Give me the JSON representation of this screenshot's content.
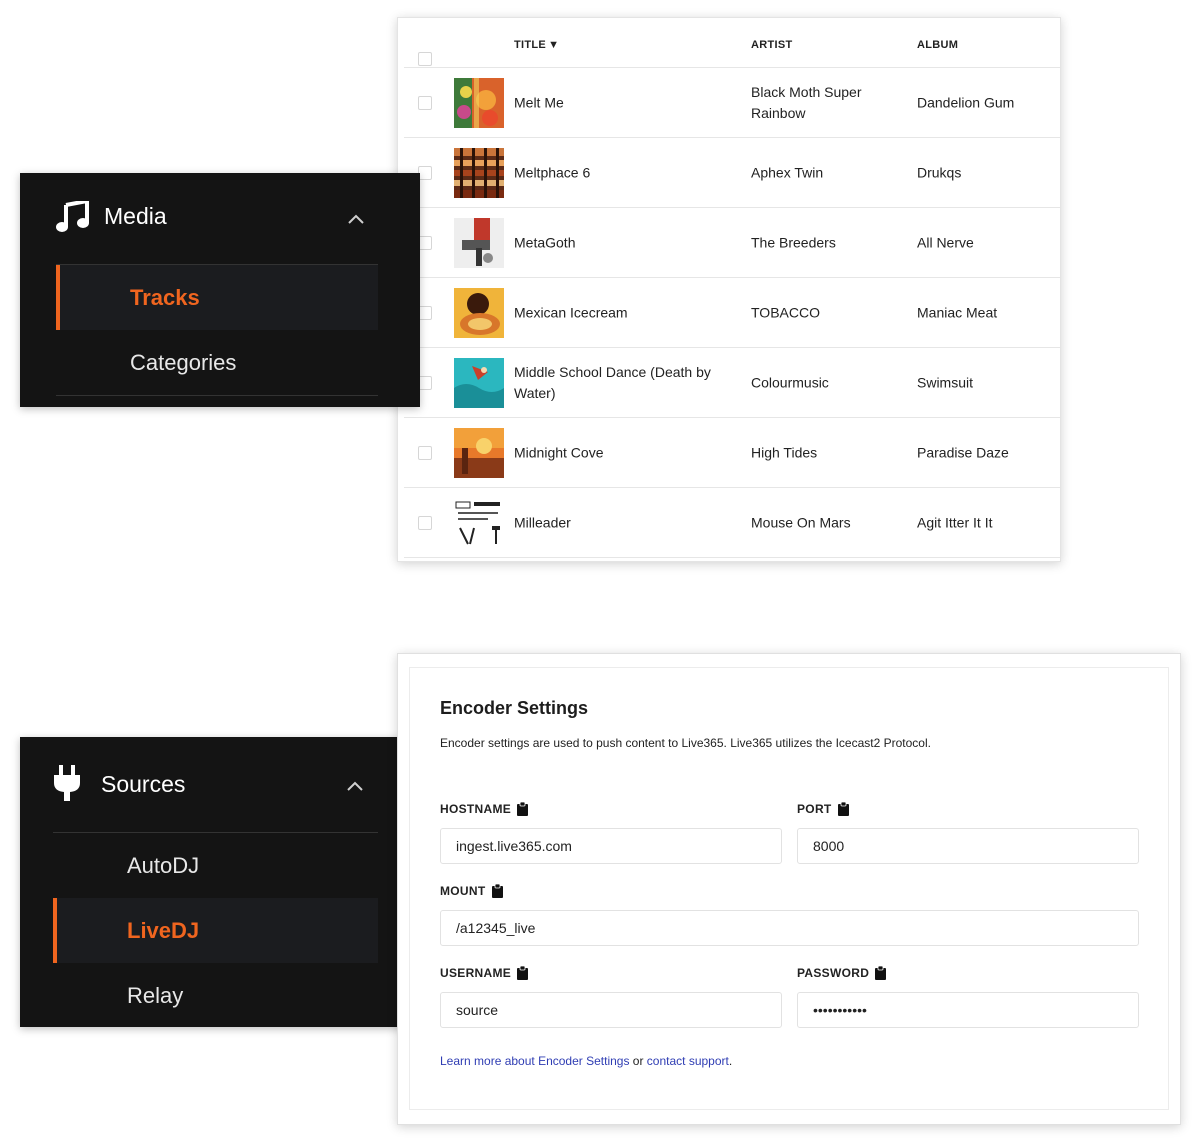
{
  "tracks": {
    "headers": {
      "title": "TITLE",
      "artist": "ARTIST",
      "album": "ALBUM"
    },
    "sort_indicator": "▼",
    "rows": [
      {
        "title": "Melt Me",
        "artist": "Black Moth Super Rainbow",
        "album": "Dandelion Gum"
      },
      {
        "title": "Meltphace 6",
        "artist": "Aphex Twin",
        "album": "Drukqs"
      },
      {
        "title": "MetaGoth",
        "artist": "The Breeders",
        "album": "All Nerve"
      },
      {
        "title": "Mexican Icecream",
        "artist": "TOBACCO",
        "album": "Maniac Meat"
      },
      {
        "title": "Middle School Dance (Death by Water)",
        "artist": "Colourmusic",
        "album": "Swimsuit"
      },
      {
        "title": "Midnight Cove",
        "artist": "High Tides",
        "album": "Paradise Daze"
      },
      {
        "title": "Milleader",
        "artist": "Mouse On Mars",
        "album": "Agit Itter It It"
      }
    ]
  },
  "media_nav": {
    "title": "Media",
    "icon": "music-note-icon",
    "items": [
      {
        "label": "Tracks",
        "active": true
      },
      {
        "label": "Categories",
        "active": false
      }
    ]
  },
  "sources_nav": {
    "title": "Sources",
    "icon": "plug-icon",
    "items": [
      {
        "label": "AutoDJ",
        "active": false
      },
      {
        "label": "LiveDJ",
        "active": true
      },
      {
        "label": "Relay",
        "active": false
      }
    ]
  },
  "encoder": {
    "title": "Encoder Settings",
    "description": "Encoder settings are used to push content to Live365. Live365 utilizes the Icecast2 Protocol.",
    "hostname_label": "HOSTNAME",
    "hostname_value": "ingest.live365.com",
    "port_label": "PORT",
    "port_value": "8000",
    "mount_label": "MOUNT",
    "mount_value": "/a12345_live",
    "username_label": "USERNAME",
    "username_value": "source",
    "password_label": "PASSWORD",
    "password_value": "•••••••••••",
    "footer_link1": "Learn more about Encoder Settings",
    "footer_or": " or ",
    "footer_link2": "contact support",
    "footer_end": "."
  },
  "colors": {
    "accent": "#f0651f",
    "panel_bg": "#141414",
    "link": "#2f3db3"
  }
}
